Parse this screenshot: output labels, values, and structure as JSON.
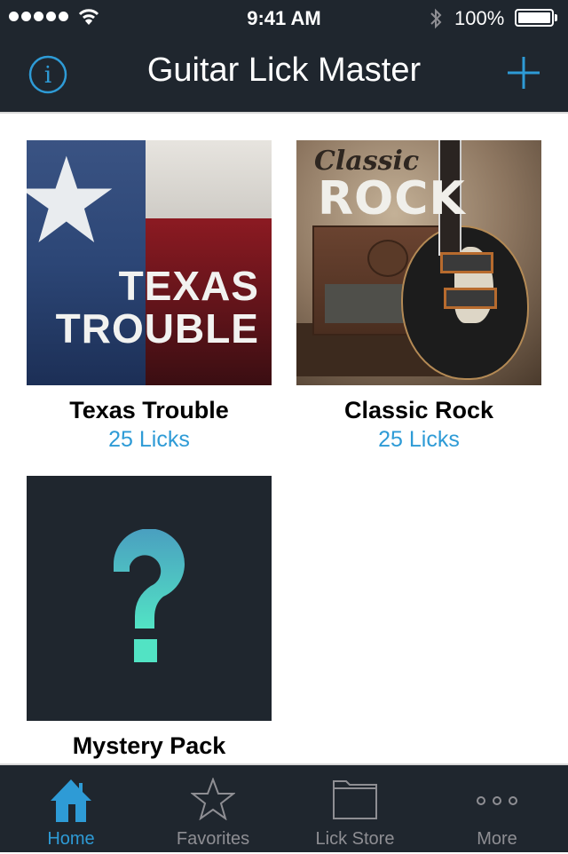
{
  "status_bar": {
    "signal_bars": 5,
    "time": "9:41 AM",
    "battery_percent": "100%",
    "icons": [
      "signal-dots-icon",
      "wifi-icon",
      "bluetooth-icon",
      "battery-icon"
    ]
  },
  "nav": {
    "title": "Guitar Lick Master",
    "left_icon": "info-icon",
    "right_icon": "plus-icon",
    "accent_color": "#2e9bd6"
  },
  "packs": [
    {
      "name": "Texas Trouble",
      "count": "25 Licks",
      "art_text_1": "TEXAS",
      "art_text_2": "TROUBLE"
    },
    {
      "name": "Classic Rock",
      "count": "25 Licks",
      "art_text_1": "Classic",
      "art_text_2": "ROCK"
    },
    {
      "name": "Mystery Pack",
      "art_glyph": "?"
    }
  ],
  "tabs": [
    {
      "label": "Home",
      "icon": "home-icon",
      "active": true
    },
    {
      "label": "Favorites",
      "icon": "star-icon",
      "active": false
    },
    {
      "label": "Lick Store",
      "icon": "folder-icon",
      "active": false
    },
    {
      "label": "More",
      "icon": "more-icon",
      "active": false
    }
  ]
}
